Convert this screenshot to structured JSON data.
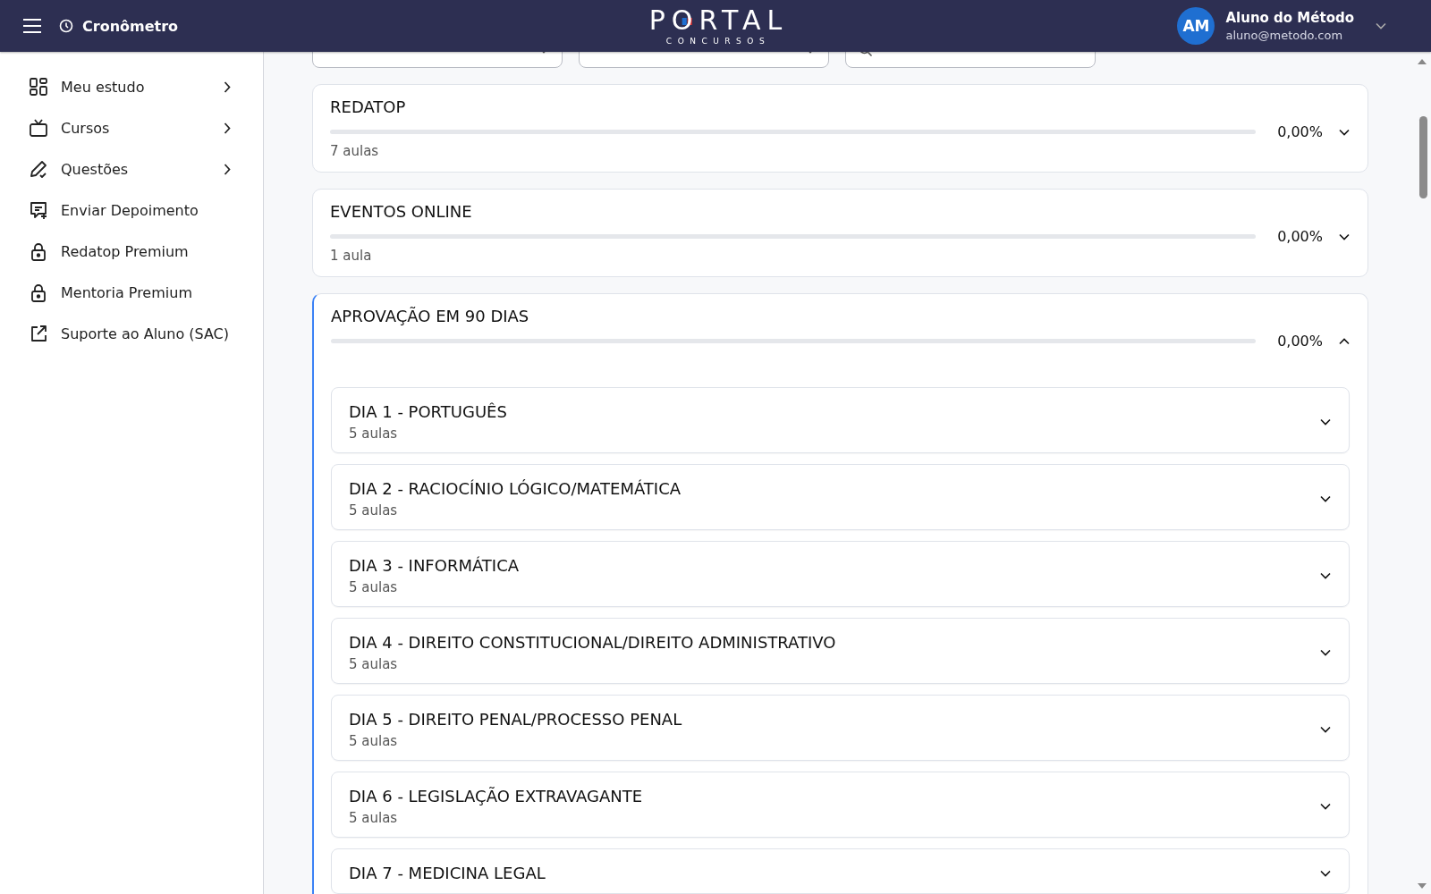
{
  "header": {
    "timer_label": "Cronômetro",
    "logo": {
      "word": "PORTAL",
      "subtitle": "CONCURSOS"
    },
    "user": {
      "initials": "AM",
      "name": "Aluno do Método",
      "email": "aluno@metodo.com"
    }
  },
  "sidebar": {
    "items": [
      {
        "label": "Meu estudo",
        "has_submenu": true
      },
      {
        "label": "Cursos",
        "has_submenu": true
      },
      {
        "label": "Questões",
        "has_submenu": true
      },
      {
        "label": "Enviar Depoimento",
        "has_submenu": false
      },
      {
        "label": "Redatop Premium",
        "has_submenu": false
      },
      {
        "label": "Mentoria Premium",
        "has_submenu": false
      },
      {
        "label": "Suporte ao Aluno (SAC)",
        "has_submenu": false
      }
    ]
  },
  "filters": [
    {
      "kind": "select"
    },
    {
      "kind": "select"
    },
    {
      "kind": "search"
    }
  ],
  "courses": [
    {
      "title": "REDATOP",
      "count": "7 aulas",
      "level": 0,
      "reading": "0,00%",
      "expanded": false
    },
    {
      "title": "EVENTOS ONLINE",
      "count": "1 aula",
      "level": 0,
      "reading": "0,00%",
      "expanded": false
    },
    {
      "title": "APROVAÇÃO EM 90 DIAS",
      "level": 0,
      "reading": "0,00%",
      "expanded": true,
      "modules": [
        {
          "title": "DIA 1 - PORTUGUÊS",
          "count": "5 aulas",
          "expanded": false
        },
        {
          "title": "DIA 2 - RACIOCÍNIO LÓGICO/MATEMÁTICA",
          "count": "5 aulas",
          "expanded": false
        },
        {
          "title": "DIA 3 - INFORMÁTICA",
          "count": "5 aulas",
          "expanded": false
        },
        {
          "title": "DIA 4 - DIREITO CONSTITUCIONAL/DIREITO ADMINISTRATIVO",
          "count": "5 aulas",
          "expanded": false
        },
        {
          "title": "DIA 5 - DIREITO PENAL/PROCESSO PENAL",
          "count": "5 aulas",
          "expanded": false
        },
        {
          "title": "DIA 6 - LEGISLAÇÃO EXTRAVAGANTE",
          "count": "5 aulas",
          "expanded": false
        },
        {
          "title": "DIA 7 - MEDICINA LEGAL",
          "expanded": false
        }
      ]
    }
  ]
}
